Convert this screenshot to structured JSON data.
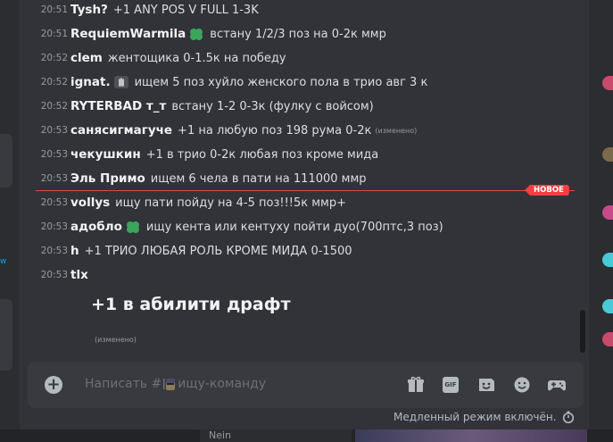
{
  "messages": [
    {
      "time": "20:51",
      "author": "Tysh?",
      "content": "+1 ANY POS V FULL 1-3K"
    },
    {
      "time": "20:51",
      "author": "RequiemWarmila",
      "badge": "clover-badge-icon",
      "content": "встану 1/2/3 поз на 0-2к ммр"
    },
    {
      "time": "20:52",
      "author": "clem",
      "content": "жентощика 0-1.5к на победу"
    },
    {
      "time": "20:52",
      "author": "ignat.",
      "badge": "hand-badge-icon",
      "content": "ищем 5 поз хуйло женского пола в трио авг 3 к"
    },
    {
      "time": "20:52",
      "author": "RYTERBAD т_т",
      "content": "встану 1-2 0-3к (фулку с войсом)"
    },
    {
      "time": "20:53",
      "author": "санясигмагуче",
      "content": "+1 на любую поз 198 рума 0-2к",
      "edited": "(изменено)"
    },
    {
      "time": "20:53",
      "author": "чекушкин",
      "content": "+1 в трио 0-2к любая поз кроме мида"
    },
    {
      "time": "20:53",
      "author": "Эль Примо",
      "content": "ищем 6 чела в пати на 111000 ммр"
    },
    {
      "time": "20:53",
      "author": "vollys",
      "content": "ищу пати пойду на 4-5 поз!!!5к ммр+"
    },
    {
      "time": "20:53",
      "author": "адобло",
      "badge": "clover-badge-icon",
      "content": "ищу кента или кентуху пойти дуо(700птс,3 поз)"
    },
    {
      "time": "20:53",
      "author": "h",
      "content": "+1 ТРИО ЛЮБАЯ РОЛЬ КРОМЕ МИДА 0-1500"
    },
    {
      "time": "20:53",
      "author": "tlx",
      "content": ""
    }
  ],
  "new_divider_label": "НОВОЕ",
  "last_message": {
    "content": "+1 в абилити драфт",
    "edited": "(изменено)"
  },
  "composer": {
    "placeholder_prefix": "Написать #",
    "placeholder_channel": "ищу-команду",
    "gif_label": "GIF"
  },
  "slowmode_text": "Медленный режим включён.",
  "bottom_peek_text": "Nein",
  "left_peek_text": "w",
  "colors": {
    "accent_red": "#f23f43",
    "link_blue": "#00a8fc",
    "clover_green": "#3ba55d"
  }
}
